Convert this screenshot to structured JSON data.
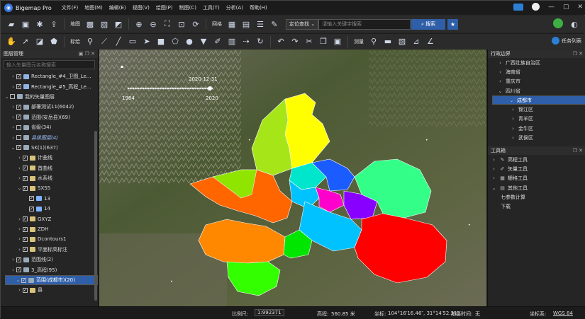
{
  "app": {
    "name": "Bigemap Pro"
  },
  "menu": [
    "文件(F)",
    "地图(M)",
    "编辑(E)",
    "视图(V)",
    "绘图(P)",
    "制图(C)",
    "工具(T)",
    "分析(A)",
    "帮助(H)"
  ],
  "toolbar1": {
    "map_label": "地图",
    "grid_label": "网格",
    "locate_mode": "定位查找",
    "search_placeholder": "请输入关键字搜索",
    "search_button": "搜索"
  },
  "toolbar2": {
    "annotate_label": "标绘",
    "measure_label": "测量",
    "task_list": "任务列表"
  },
  "left_panel": {
    "title": "图层管理",
    "search_placeholder": "输入矢量图元名称搜索",
    "rows": [
      {
        "indent": 1,
        "chev": "›",
        "checked": true,
        "icon": "raster",
        "label": "Rectangle_#4_卫图_Le...",
        "style": "normal"
      },
      {
        "indent": 1,
        "chev": "›",
        "checked": true,
        "icon": "raster",
        "label": "Rectangle_#5_高程_Le...",
        "style": "normal"
      },
      {
        "indent": 0,
        "chev": "⌄",
        "checked": false,
        "icon": "layers",
        "label": "我的矢量图层",
        "style": "normal"
      },
      {
        "indent": 1,
        "chev": "›",
        "checked": true,
        "icon": "layers",
        "label": "部署测试11(6042)",
        "style": "normal"
      },
      {
        "indent": 1,
        "chev": "›",
        "checked": true,
        "icon": "layers",
        "label": "范围(安岳县)(69)",
        "style": "normal"
      },
      {
        "indent": 1,
        "chev": "›",
        "checked": false,
        "icon": "layers",
        "label": "省级(34)",
        "style": "normal"
      },
      {
        "indent": 1,
        "chev": "›",
        "checked": false,
        "icon": "layers",
        "label": "县级图层(4)",
        "style": "italic"
      },
      {
        "indent": 1,
        "chev": "⌄",
        "checked": true,
        "icon": "layers",
        "label": "SK(1)(637)",
        "style": "normal"
      },
      {
        "indent": 2,
        "chev": "›",
        "checked": true,
        "icon": "folder",
        "label": "计曲线",
        "style": "normal"
      },
      {
        "indent": 2,
        "chev": "›",
        "checked": true,
        "icon": "folder",
        "label": "首曲线",
        "style": "normal"
      },
      {
        "indent": 2,
        "chev": "›",
        "checked": true,
        "icon": "folder",
        "label": "水系线",
        "style": "normal"
      },
      {
        "indent": 2,
        "chev": "⌄",
        "checked": true,
        "icon": "folder",
        "label": "SXSS",
        "style": "normal"
      },
      {
        "indent": 3,
        "chev": "",
        "checked": true,
        "icon": "line",
        "label": "13",
        "style": "normal"
      },
      {
        "indent": 3,
        "chev": "",
        "checked": true,
        "icon": "line",
        "label": "14",
        "style": "normal"
      },
      {
        "indent": 2,
        "chev": "›",
        "checked": true,
        "icon": "folder",
        "label": "GXYZ",
        "style": "normal"
      },
      {
        "indent": 2,
        "chev": "›",
        "checked": true,
        "icon": "folder",
        "label": "ZDH",
        "style": "normal"
      },
      {
        "indent": 2,
        "chev": "›",
        "checked": true,
        "icon": "folder",
        "label": "Dcontours1",
        "style": "normal"
      },
      {
        "indent": 2,
        "chev": "›",
        "checked": true,
        "icon": "folder",
        "label": "平面标高标注",
        "style": "normal"
      },
      {
        "indent": 1,
        "chev": "›",
        "checked": true,
        "icon": "layers",
        "label": "范围线(2)",
        "style": "normal"
      },
      {
        "indent": 1,
        "chev": "›",
        "checked": true,
        "icon": "layers",
        "label": "3_高程(95)",
        "style": "normal"
      },
      {
        "indent": 1,
        "chev": "⌄",
        "checked": true,
        "icon": "layers",
        "label": "范围(成都市)(20)",
        "style": "selected"
      },
      {
        "indent": 2,
        "chev": "›",
        "checked": true,
        "icon": "folder",
        "label": "县",
        "style": "normal"
      }
    ]
  },
  "map": {
    "timeline_date": "2020-12-31",
    "timeline_start": "1984",
    "timeline_end": "2020",
    "district_colors": [
      "#ffff00",
      "#a6e619",
      "#1a5cff",
      "#00e6cc",
      "#00c2ff",
      "#ff00cc",
      "#8800ff",
      "#33ff88",
      "#ff0000",
      "#ff6600",
      "#7cfc00",
      "#ff8800",
      "#33ff00",
      "#00e600"
    ]
  },
  "right_panel": {
    "admin_title": "行政边界",
    "admin_rows": [
      {
        "indent": 1,
        "chev": "›",
        "label": "广西壮族自治区",
        "selected": false
      },
      {
        "indent": 1,
        "chev": "›",
        "label": "海南省",
        "selected": false
      },
      {
        "indent": 1,
        "chev": "›",
        "label": "重庆市",
        "selected": false
      },
      {
        "indent": 1,
        "chev": "⌄",
        "label": "四川省",
        "selected": false
      },
      {
        "indent": 2,
        "chev": "⌄",
        "label": "成都市",
        "selected": true
      },
      {
        "indent": 3,
        "chev": "›",
        "label": "锦江区",
        "selected": false
      },
      {
        "indent": 3,
        "chev": "›",
        "label": "青羊区",
        "selected": false
      },
      {
        "indent": 3,
        "chev": "›",
        "label": "金牛区",
        "selected": false
      },
      {
        "indent": 3,
        "chev": "›",
        "label": "武侯区",
        "selected": false
      }
    ],
    "tools_title": "工具箱",
    "tools_rows": [
      {
        "indent": 0,
        "chev": "›",
        "icon": "✎",
        "label": "高程工具"
      },
      {
        "indent": 0,
        "chev": "›",
        "icon": "✐",
        "label": "矢量工具"
      },
      {
        "indent": 0,
        "chev": "›",
        "icon": "▦",
        "label": "栅格工具"
      },
      {
        "indent": 0,
        "chev": "⌄",
        "icon": "▤",
        "label": "其他工具"
      },
      {
        "indent": 1,
        "chev": "",
        "icon": "",
        "label": "七参数计算"
      },
      {
        "indent": 1,
        "chev": "",
        "icon": "",
        "label": "下载"
      }
    ]
  },
  "status": {
    "scale_label": "比例尺:",
    "scale_value": "1:992371",
    "elev_label": "高程:",
    "elev_value": "560.85 米",
    "coord_label": "坐标:",
    "coord_value": "104°16′16.46″, 31°14′52.31″",
    "shot_label": "拍摄时间:",
    "shot_value": "无",
    "crs_label": "坐标系:",
    "crs_value": "WGS 84"
  }
}
